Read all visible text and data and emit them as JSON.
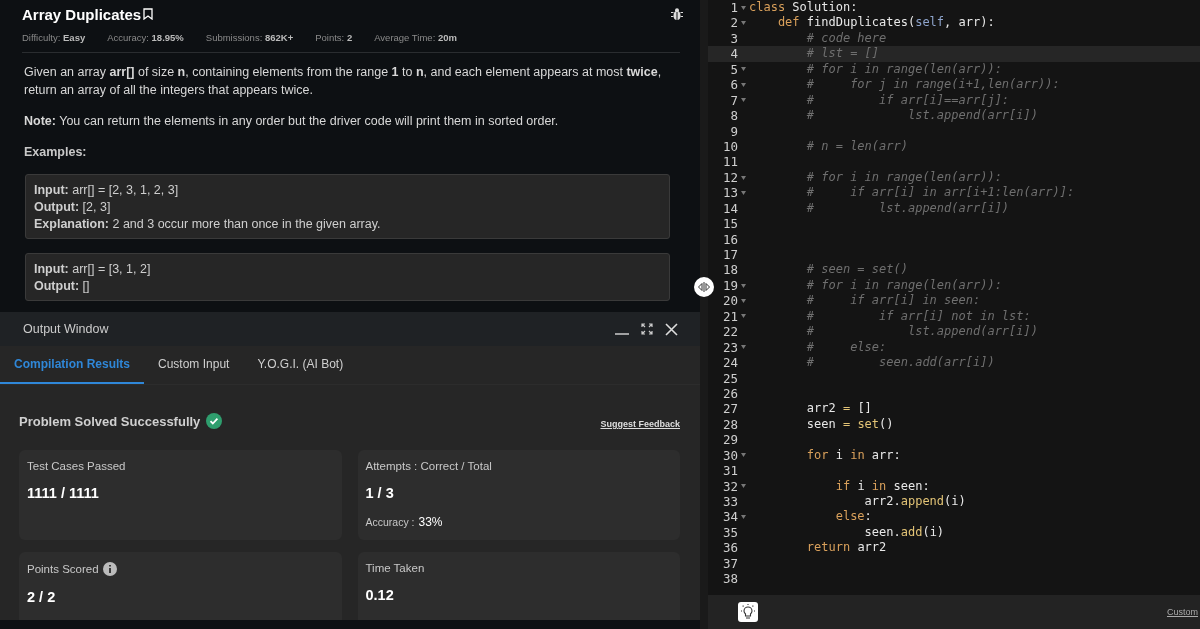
{
  "problem": {
    "title": "Array Duplicates",
    "meta": [
      {
        "label": "Difficulty:",
        "value": "Easy"
      },
      {
        "label": "Accuracy:",
        "value": "18.95%"
      },
      {
        "label": "Submissions:",
        "value": "862K+"
      },
      {
        "label": "Points:",
        "value": "2"
      },
      {
        "label": "Average Time:",
        "value": "20m"
      }
    ],
    "description": "Given an array **arr[]** of size **n**, containing elements from the range **1** to **n**, and each element appears at most **twice**, return an array of all the integers that appears twice.",
    "note": "**Note:** You can return the elements in any order but the driver code will print them in sorted order.",
    "examples_heading": "Examples:",
    "examples": [
      {
        "lines": [
          "**Input:** arr[] = [2, 3, 1, 2, 3]",
          "**Output:** [2, 3]",
          "**Explanation:** 2 and 3 occur more than once in the given array."
        ]
      },
      {
        "lines": [
          "**Input:** arr[] = [3, 1, 2]",
          "**Output:** []"
        ]
      }
    ]
  },
  "output_window": {
    "title": "Output Window",
    "tabs": [
      {
        "label": "Compilation Results",
        "selected": true
      },
      {
        "label": "Custom Input",
        "selected": false
      },
      {
        "label": "Y.O.G.I. (AI Bot)",
        "selected": false
      }
    ],
    "status": "Problem Solved Successfully",
    "feedback_link": "Suggest Feedback",
    "cards": [
      {
        "label": "Test Cases Passed",
        "info": false,
        "value": "1111 / 1111"
      },
      {
        "label": "Attempts : Correct / Total",
        "info": false,
        "value": "1 / 3",
        "extra_label": "Accuracy :",
        "extra_value": "33%"
      },
      {
        "label": "Points Scored",
        "info": true,
        "value": "2 / 2"
      },
      {
        "label": "Time Taken",
        "info": false,
        "value": "0.12"
      }
    ]
  },
  "editor": {
    "lines": [
      {
        "number": "1",
        "fold": true,
        "active": false,
        "tokens": [
          {
            "kind": "keyword",
            "text": "class"
          },
          {
            "kind": "plain",
            "text": " Solution:"
          }
        ]
      },
      {
        "number": "2",
        "fold": true,
        "active": false,
        "tokens": [
          {
            "kind": "keyword",
            "text": "    def"
          },
          {
            "kind": "plain",
            "text": " findDuplicates("
          },
          {
            "kind": "self",
            "text": "self"
          },
          {
            "kind": "plain",
            "text": ", arr):"
          }
        ]
      },
      {
        "number": "3",
        "fold": false,
        "active": false,
        "tokens": [
          {
            "kind": "comment",
            "text": "        # code here"
          }
        ]
      },
      {
        "number": "4",
        "fold": false,
        "active": true,
        "tokens": [
          {
            "kind": "comment",
            "text": "        # lst = []"
          }
        ]
      },
      {
        "number": "5",
        "fold": true,
        "active": false,
        "tokens": [
          {
            "kind": "comment",
            "text": "        # for i in range(len(arr)):"
          }
        ]
      },
      {
        "number": "6",
        "fold": true,
        "active": false,
        "tokens": [
          {
            "kind": "comment",
            "text": "        #     for j in range(i+1,len(arr)):"
          }
        ]
      },
      {
        "number": "7",
        "fold": true,
        "active": false,
        "tokens": [
          {
            "kind": "comment",
            "text": "        #         if arr[i]==arr[j]:"
          }
        ]
      },
      {
        "number": "8",
        "fold": false,
        "active": false,
        "tokens": [
          {
            "kind": "comment",
            "text": "        #             lst.append(arr[i])"
          }
        ]
      },
      {
        "number": "9",
        "fold": false,
        "active": false
      },
      {
        "number": "10",
        "fold": false,
        "active": false,
        "tokens": [
          {
            "kind": "comment",
            "text": "        # n = len(arr)"
          }
        ]
      },
      {
        "number": "11",
        "fold": false,
        "active": false
      },
      {
        "number": "12",
        "fold": true,
        "active": false,
        "tokens": [
          {
            "kind": "comment",
            "text": "        # for i in range(len(arr)):"
          }
        ]
      },
      {
        "number": "13",
        "fold": true,
        "active": false,
        "tokens": [
          {
            "kind": "comment",
            "text": "        #     if arr[i] in arr[i+1:len(arr)]:"
          }
        ]
      },
      {
        "number": "14",
        "fold": false,
        "active": false,
        "tokens": [
          {
            "kind": "comment",
            "text": "        #         lst.append(arr[i])"
          }
        ]
      },
      {
        "number": "15",
        "fold": false,
        "active": false
      },
      {
        "number": "16",
        "fold": false,
        "active": false
      },
      {
        "number": "17",
        "fold": false,
        "active": false
      },
      {
        "number": "18",
        "fold": false,
        "active": false,
        "tokens": [
          {
            "kind": "comment",
            "text": "        # seen = set()"
          }
        ]
      },
      {
        "number": "19",
        "fold": true,
        "active": false,
        "tokens": [
          {
            "kind": "comment",
            "text": "        # for i in range(len(arr)):"
          }
        ]
      },
      {
        "number": "20",
        "fold": true,
        "active": false,
        "tokens": [
          {
            "kind": "comment",
            "text": "        #     if arr[i] in seen:"
          }
        ]
      },
      {
        "number": "21",
        "fold": true,
        "active": false,
        "tokens": [
          {
            "kind": "comment",
            "text": "        #         if arr[i] not in lst:"
          }
        ]
      },
      {
        "number": "22",
        "fold": false,
        "active": false,
        "tokens": [
          {
            "kind": "comment",
            "text": "        #             lst.append(arr[i])"
          }
        ]
      },
      {
        "number": "23",
        "fold": true,
        "active": false,
        "tokens": [
          {
            "kind": "comment",
            "text": "        #     else:"
          }
        ]
      },
      {
        "number": "24",
        "fold": false,
        "active": false,
        "tokens": [
          {
            "kind": "comment",
            "text": "        #         seen.add(arr[i])"
          }
        ]
      },
      {
        "number": "25",
        "fold": false,
        "active": false
      },
      {
        "number": "26",
        "fold": false,
        "active": false
      },
      {
        "number": "27",
        "fold": false,
        "active": false,
        "tokens": [
          {
            "kind": "plain",
            "text": "        arr2 "
          },
          {
            "kind": "builtin",
            "text": "="
          },
          {
            "kind": "plain",
            "text": " []"
          }
        ]
      },
      {
        "number": "28",
        "fold": false,
        "active": false,
        "tokens": [
          {
            "kind": "plain",
            "text": "        seen "
          },
          {
            "kind": "builtin",
            "text": "="
          },
          {
            "kind": "builtin",
            "text": " set"
          },
          {
            "kind": "plain",
            "text": "()"
          }
        ]
      },
      {
        "number": "29",
        "fold": false,
        "active": false
      },
      {
        "number": "30",
        "fold": true,
        "active": false,
        "tokens": [
          {
            "kind": "keyword",
            "text": "        for"
          },
          {
            "kind": "plain",
            "text": " i "
          },
          {
            "kind": "keyword",
            "text": "in"
          },
          {
            "kind": "plain",
            "text": " arr:"
          }
        ]
      },
      {
        "number": "31",
        "fold": false,
        "active": false
      },
      {
        "number": "32",
        "fold": true,
        "active": false,
        "tokens": [
          {
            "kind": "keyword",
            "text": "            if"
          },
          {
            "kind": "plain",
            "text": " i "
          },
          {
            "kind": "keyword",
            "text": "in"
          },
          {
            "kind": "plain",
            "text": " seen:"
          }
        ]
      },
      {
        "number": "33",
        "fold": false,
        "active": false,
        "tokens": [
          {
            "kind": "plain",
            "text": "                arr2."
          },
          {
            "kind": "builtin",
            "text": "append"
          },
          {
            "kind": "plain",
            "text": "(i)"
          }
        ]
      },
      {
        "number": "34",
        "fold": true,
        "active": false,
        "tokens": [
          {
            "kind": "keyword",
            "text": "            else"
          },
          {
            "kind": "plain",
            "text": ":"
          }
        ]
      },
      {
        "number": "35",
        "fold": false,
        "active": false,
        "tokens": [
          {
            "kind": "plain",
            "text": "                seen."
          },
          {
            "kind": "builtin",
            "text": "add"
          },
          {
            "kind": "plain",
            "text": "(i)"
          }
        ]
      },
      {
        "number": "36",
        "fold": false,
        "active": false,
        "tokens": [
          {
            "kind": "keyword",
            "text": "        return"
          },
          {
            "kind": "plain",
            "text": " arr2"
          }
        ]
      },
      {
        "number": "37",
        "fold": false,
        "active": false
      },
      {
        "number": "38",
        "fold": false,
        "active": false
      }
    ],
    "footer_link": "Custom"
  }
}
